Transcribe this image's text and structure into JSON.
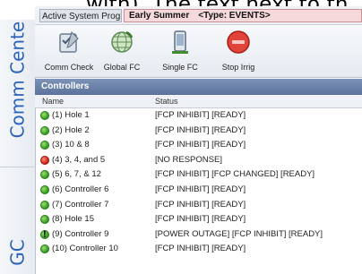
{
  "caption": {
    "text": "with). The text next to th"
  },
  "left_tabs": [
    {
      "label": "Comm Center"
    },
    {
      "label": "GC"
    }
  ],
  "program": {
    "label": "Active System Program",
    "value": "Early Summer",
    "type": "<Type: EVENTS>"
  },
  "toolbar": {
    "buttons": [
      {
        "label": "Comm Check",
        "icon": "checklist-icon"
      },
      {
        "label": "Global FC",
        "icon": "globe-icon"
      },
      {
        "label": "Single FC",
        "icon": "device-icon"
      },
      {
        "label": "Stop Irrig",
        "icon": "stop-icon"
      }
    ]
  },
  "controllers": {
    "title": "Controllers",
    "columns": {
      "name": "Name",
      "status": "Status"
    },
    "rows": [
      {
        "indicator": "green",
        "name": "(1)  Hole 1",
        "status": "[FCP INHIBIT] [READY]"
      },
      {
        "indicator": "green",
        "name": "(2)  Hole 2",
        "status": "[FCP INHIBIT] [READY]"
      },
      {
        "indicator": "green",
        "name": "(3)  10 & 8",
        "status": "[FCP INHIBIT] [READY]"
      },
      {
        "indicator": "red",
        "name": "(4)  3, 4, and 5",
        "status": "[NO RESPONSE]"
      },
      {
        "indicator": "green",
        "name": "(5)  6, 7, & 12",
        "status": "[FCP INHIBIT] [FCP CHANGED] [READY]"
      },
      {
        "indicator": "green",
        "name": "(6)  Controller 6",
        "status": "[FCP INHIBIT] [READY]"
      },
      {
        "indicator": "green",
        "name": "(7)  Controller 7",
        "status": "[FCP INHIBIT] [READY]"
      },
      {
        "indicator": "green",
        "name": "(8)  Hole 15",
        "status": "[FCP INHIBIT] [READY]"
      },
      {
        "indicator": "warn",
        "name": "(9)  Controller 9",
        "status": "[POWER OUTAGE] [FCP INHIBIT] [READY]"
      },
      {
        "indicator": "green",
        "name": "(10)  Controller 10",
        "status": "[FCP INHIBIT] [READY]"
      }
    ]
  }
}
